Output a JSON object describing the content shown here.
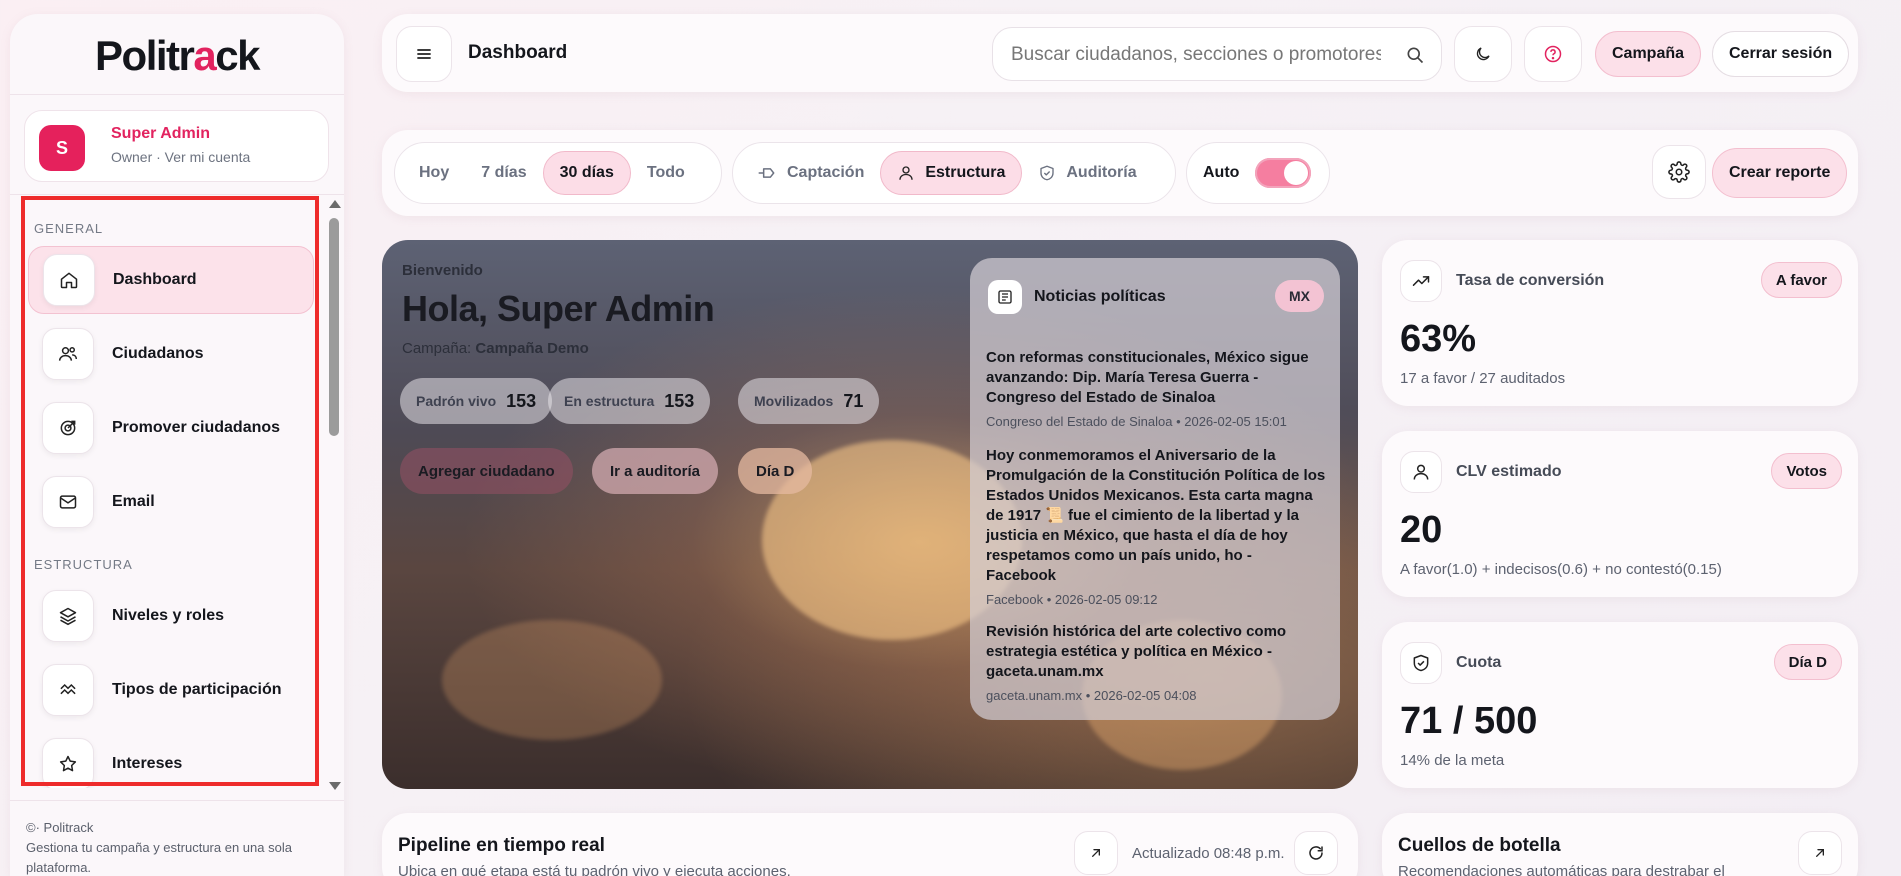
{
  "brand": {
    "logo_main": "Politr",
    "logo_accent": "a",
    "logo_end": "ck",
    "accent_color": "#e2235f"
  },
  "user": {
    "initial": "S",
    "name": "Super Admin",
    "role": "Owner · Ver mi cuenta"
  },
  "sidebar": {
    "sections": [
      {
        "title": "GENERAL",
        "items": [
          {
            "label": "Dashboard",
            "icon": "home-icon",
            "active": true
          },
          {
            "label": "Ciudadanos",
            "icon": "users-icon"
          },
          {
            "label": "Promover ciudadanos",
            "icon": "target-icon"
          },
          {
            "label": "Email",
            "icon": "mail-icon"
          }
        ]
      },
      {
        "title": "ESTRUCTURA",
        "items": [
          {
            "label": "Niveles y roles",
            "icon": "layers-icon"
          },
          {
            "label": "Tipos de participación",
            "icon": "wave-icon"
          },
          {
            "label": "Intereses",
            "icon": "star-icon"
          }
        ]
      }
    ]
  },
  "footer": {
    "line1": "©· Politrack",
    "line2": "Gestiona tu campaña y estructura en una sola plataforma."
  },
  "header": {
    "title": "Dashboard",
    "search_placeholder": "Buscar ciudadanos, secciones o promotores",
    "campaign_btn": "Campaña",
    "logout_btn": "Cerrar sesión"
  },
  "filters": {
    "ranges": [
      {
        "label": "Hoy"
      },
      {
        "label": "7 días"
      },
      {
        "label": "30 días",
        "active": true
      },
      {
        "label": "Todo"
      }
    ],
    "views": [
      {
        "label": "Captación",
        "icon": "funnel-icon"
      },
      {
        "label": "Estructura",
        "icon": "person-icon",
        "active": true
      },
      {
        "label": "Auditoría",
        "icon": "shield-icon"
      }
    ],
    "auto_label": "Auto",
    "auto_on": true,
    "create_report": "Crear reporte"
  },
  "hero": {
    "welcome": "Bienvenido",
    "title": "Hola, Super Admin",
    "campaign_prefix": "Campaña:",
    "campaign_name": "Campaña Demo",
    "stats": [
      {
        "label": "Padrón vivo",
        "value": "153"
      },
      {
        "label": "En estructura",
        "value": "153"
      },
      {
        "label": "Movilizados",
        "value": "71"
      }
    ],
    "buttons": [
      "Agregar ciudadano",
      "Ir a auditoría",
      "Día D"
    ]
  },
  "news": {
    "title": "Noticias políticas",
    "tag": "MX",
    "items": [
      {
        "headline": "Con reformas constitucionales, México sigue avanzando: Dip. María Teresa Guerra - Congreso del Estado de Sinaloa",
        "meta": "Congreso del Estado de Sinaloa • 2026-02-05 15:01"
      },
      {
        "headline": "Hoy conmemoramos el Aniversario de la Promulgación de la Constitución Política de los Estados Unidos Mexicanos. Esta carta magna de 1917 📜 fue el cimiento de la libertad y la justicia en México, que hasta el día de hoy respetamos como un país unido, ho - Facebook",
        "meta": "Facebook • 2026-02-05 09:12"
      },
      {
        "headline": "Revisión histórica del arte colectivo como estrategia estética y política en México - gaceta.unam.mx",
        "meta": "gaceta.unam.mx • 2026-02-05 04:08"
      }
    ]
  },
  "kpis": [
    {
      "label": "Tasa de conversión",
      "badge": "A favor",
      "value": "63%",
      "sub": "17 a favor / 27 auditados",
      "icon": "trend-up-icon"
    },
    {
      "label": "CLV estimado",
      "badge": "Votos",
      "value": "20",
      "sub": "A favor(1.0) + indecisos(0.6) + no contestó(0.15)",
      "icon": "person-icon"
    },
    {
      "label": "Cuota",
      "badge": "Día D",
      "value": "71 / 500",
      "sub": "14% de la meta",
      "icon": "shield-check-icon"
    }
  ],
  "pipeline": {
    "title": "Pipeline en tiempo real",
    "sub": "Ubica en qué etapa está tu padrón vivo y ejecuta acciones.",
    "updated": "Actualizado 08:48 p.m."
  },
  "bottlenecks": {
    "title": "Cuellos de botella",
    "sub": "Recomendaciones automáticas para destrabar el"
  }
}
